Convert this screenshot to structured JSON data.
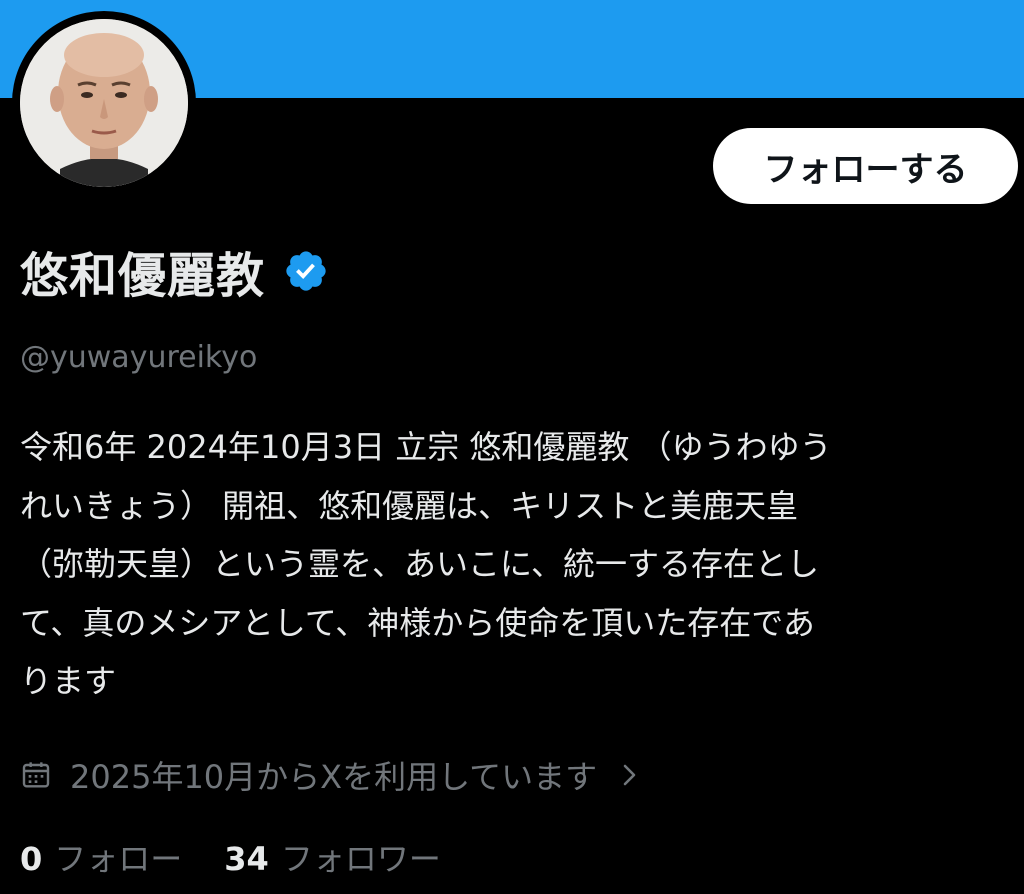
{
  "colors": {
    "banner": "#1d9bf0",
    "background": "#000000",
    "verified_badge": "#1d9bf0",
    "primary_text": "#e7e9ea",
    "secondary_text": "#71767b"
  },
  "profile": {
    "display_name": "悠和優麗教",
    "handle": "@yuwayureikyo",
    "verified_icon": "verified-badge-icon",
    "avatar_icon": "avatar"
  },
  "actions": {
    "follow_label": "フォローする"
  },
  "bio": {
    "lines": [
      "令和6年 2024年10月3日 立宗 悠和優麗教 （ゆうわゆう",
      "れいきょう） 開祖、悠和優麗は、キリストと美鹿天皇",
      "（弥勒天皇）という霊を、あいこに、統一する存在とし",
      "て、真のメシアとして、神様から使命を頂いた存在であ",
      "ります"
    ]
  },
  "joined": {
    "icon": "calendar-icon",
    "text": "2025年10月からXを利用しています",
    "chevron_icon": "chevron-right-icon"
  },
  "stats": {
    "following_count": "0",
    "following_label": "フォロー",
    "followers_count": "34",
    "followers_label": "フォロワー"
  }
}
